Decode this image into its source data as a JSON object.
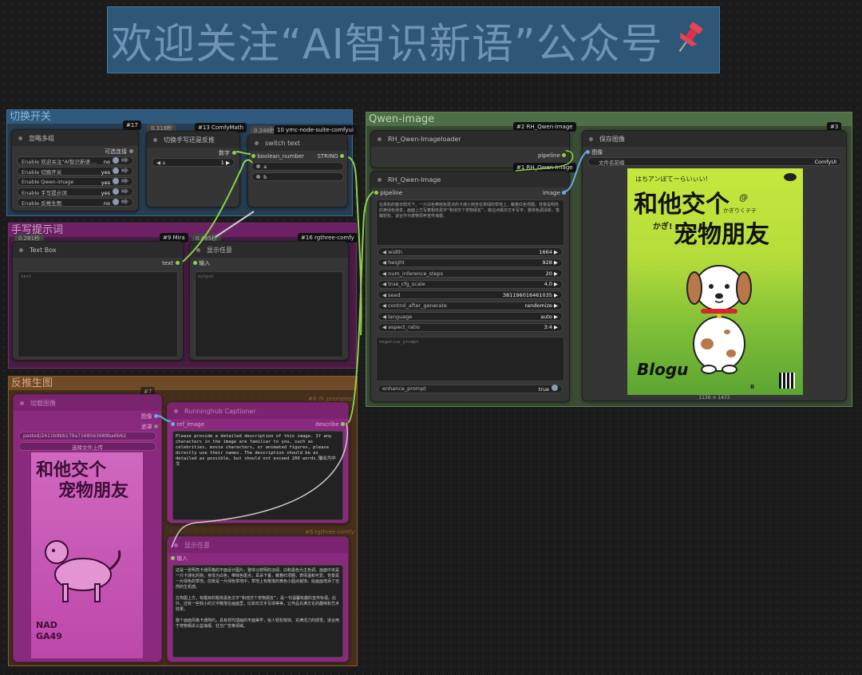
{
  "banner": {
    "text": "欢迎关注“AI智识新语”公众号",
    "pin_icon": "pushpin-icon"
  },
  "groups": {
    "switch": "切换开关",
    "handwrite": "手写提示词",
    "reverse": "反推生图",
    "qwen": "Qwen-image"
  },
  "node17": {
    "id": "#17",
    "title": "忽略多组",
    "optional_connect": "可选连接",
    "rows": [
      {
        "label": "Enable 欢迎关注“AI智识新语 ...",
        "value": "no"
      },
      {
        "label": "Enable 切换开关",
        "value": "yes"
      },
      {
        "label": "Enable Qwen-image",
        "value": "yes"
      },
      {
        "label": "Enable 手写提示词",
        "value": "yes"
      },
      {
        "label": "Enable 反推生图",
        "value": "no"
      }
    ]
  },
  "node13": {
    "timer": "0.318秒",
    "tag": "#13 ComfyMath",
    "title": "切换手写还是反推",
    "out_label": "数字",
    "widget_label": "a",
    "widget_value": "1"
  },
  "node10": {
    "timer": "0.246秒",
    "tag": "10 ymc-node-suite-comfyui",
    "title": "switch text",
    "in1": "boolean_number",
    "out1": "STRING",
    "in2": "a",
    "in3": "b"
  },
  "node9": {
    "timer": "0.281秒",
    "tag": "#9 Mira",
    "title": "Text Box",
    "out": "text",
    "placeholder": "text"
  },
  "node16": {
    "timer": "0.485秒",
    "tag": "#16 rgthree-comfy",
    "title": "显示任意",
    "in": "输入",
    "placeholder": "output"
  },
  "node7": {
    "tag": "#7",
    "title": "加载图像",
    "out1": "图像",
    "out2": "遮罩",
    "file": "pasted/2411b9bb179a7168563689ba6b62",
    "upload": "选择文件上传"
  },
  "node8": {
    "tag": "#8 rh_prompter",
    "title": "Runninghub Captioner",
    "in": "ref_image",
    "out": "describe",
    "prompt": "Please provide a detailed description of this image. If any characters in the image are familiar to you, such as celebrities, movie characters, or animated figures, please directly use their names. The description should be as detailed as possible, but should not exceed 200 words.输出为中文"
  },
  "node6": {
    "tag": "#6 rgthree-comfy",
    "title": "显示任意",
    "in": "输入",
    "p1": "这是一张明亮卡通风格的平面设计图片，整体以鲜明的淡绿、白和黑色为主色调。画面中央是一只卡通化的狗，身体为白色，带棕色斑点，耳朵下垂，戴着红项圈，表情温和可爱。背景是一片绿色的草地，前景是一片绿色草地中，草地上有散落的黄色小圆点装饰，给画面增添了自然的生机感。",
    "p2": "在构图上方，有醒目的粗体黑色文字“和他交个宠物朋友”，是一句温馨有趣的宣传标语。此外，还有一些较小的文字散落在画面里，比如日文手写体等等，让作品充满文化的趣味和艺术效果。",
    "p3": "整个画面风格卡通简约，具有现代插画的平面美学，给人轻松愉快、充满活力的感觉，适合用于宠物相关公益海报、社交广告等领域。"
  },
  "node2": {
    "tag": "#2 RH_Qwen-Image",
    "title": "RH_Qwen-Imageloader",
    "out": "pipeline"
  },
  "node1": {
    "tag": "#1 RH_Qwen-Image",
    "title": "RH_Qwen-Image",
    "in": "pipeline",
    "out": "image",
    "prompt_text": "在柔和的春日阳光下，一只白色带棕色斑点的卡通小狗坐在翠绿的草地上，戴着红色项圈。背景是明亮的黄绿色渐变，画面上方写着粗体黑字“和他交个宠物朋友”，旁边点缀日文手写字，整体色调清新，笔触轻松，适合作为宠物领养宣传海报。",
    "widgets": [
      {
        "label": "width",
        "value": "1664"
      },
      {
        "label": "height",
        "value": "928"
      },
      {
        "label": "num_inference_steps",
        "value": "20"
      },
      {
        "label": "true_cfg_scale",
        "value": "4.0"
      },
      {
        "label": "seed",
        "value": "381196016461035"
      },
      {
        "label": "control_after_generate",
        "value": "randomize"
      },
      {
        "label": "language",
        "value": "auto"
      },
      {
        "label": "aspect_ratio",
        "value": "3:4"
      }
    ],
    "neg_placeholder": "negative_prompt",
    "enhance_label": "enhance_prompt",
    "enhance_value": "true"
  },
  "node3": {
    "tag": "#3",
    "title": "保存图像",
    "in": "图像",
    "prefix_label": "文件名前缀",
    "prefix_value": "ComfyUI",
    "dims": "1136 × 1472"
  },
  "poster": {
    "top_jp": "はちアンぼてーらいぃい!",
    "title1": "和他交个",
    "title2": "宠物朋友",
    "side_jp": "かぎりくテテ",
    "small_jp": "かぎ!",
    "bottom": "Blogu",
    "mark": "B"
  },
  "poster2": {
    "title1": "和他交个",
    "title2": "宠物朋友",
    "bottom1": "NAD",
    "bottom2": "GA49"
  }
}
